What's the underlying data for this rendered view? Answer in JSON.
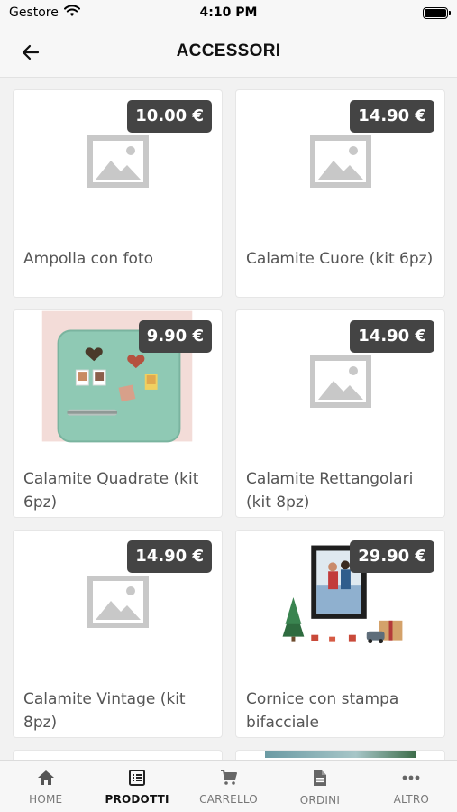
{
  "status_bar": {
    "carrier": "Gestore",
    "time": "4:10 PM"
  },
  "header": {
    "title": "ACCESSORI",
    "back_icon": "arrow-left-icon"
  },
  "products": [
    {
      "name": "Ampolla con foto",
      "price": "10.00 €",
      "image": "placeholder"
    },
    {
      "name": "Calamite Cuore (kit 6pz)",
      "price": "14.90 €",
      "image": "placeholder"
    },
    {
      "name": "Calamite Quadrate (kit 6pz)",
      "price": "9.90 €",
      "image": "fridge-photo"
    },
    {
      "name": "Calamite Rettangolari (kit 8pz)",
      "price": "14.90 €",
      "image": "placeholder"
    },
    {
      "name": "Calamite Vintage (kit 8pz)",
      "price": "14.90 €",
      "image": "placeholder"
    },
    {
      "name": "Cornice con stampa bifacciale",
      "price": "29.90 €",
      "image": "frame-photo"
    }
  ],
  "tabbar": {
    "items": [
      {
        "label": "HOME",
        "icon": "home-icon",
        "active": false
      },
      {
        "label": "PRODOTTI",
        "icon": "list-icon",
        "active": true
      },
      {
        "label": "CARRELLO",
        "icon": "cart-icon",
        "active": false
      },
      {
        "label": "ORDINI",
        "icon": "document-icon",
        "active": false
      },
      {
        "label": "ALTRO",
        "icon": "more-icon",
        "active": false
      }
    ]
  },
  "colors": {
    "badge_bg": "#444444",
    "background": "#f2f2f2",
    "card_bg": "#ffffff",
    "placeholder_gray": "#c8c8c8"
  }
}
